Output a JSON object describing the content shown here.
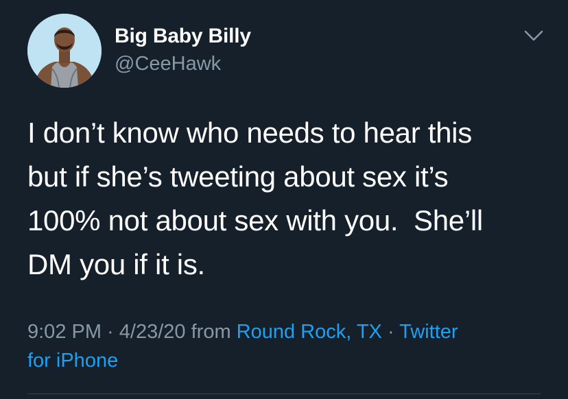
{
  "user": {
    "display_name": "Big Baby Billy",
    "handle": "@CeeHawk",
    "avatar_icon": "profile-photo"
  },
  "tweet": {
    "lines": [
      "I don’t know who needs to hear this",
      "but if she’s tweeting about sex it’s",
      "100% not about sex with you.  She’ll",
      "DM you if it is."
    ]
  },
  "meta": {
    "time": "9:02 PM",
    "separator": " · ",
    "date": "4/23/20",
    "from_text": " from ",
    "location": "Round Rock, TX",
    "source_part1": "Twitter",
    "source_part2": "for iPhone"
  },
  "colors": {
    "background": "#15202b",
    "text": "#ffffff",
    "secondary": "#8899a6",
    "link": "#1da1f2"
  },
  "icons": {
    "menu": "chevron-down-icon"
  }
}
